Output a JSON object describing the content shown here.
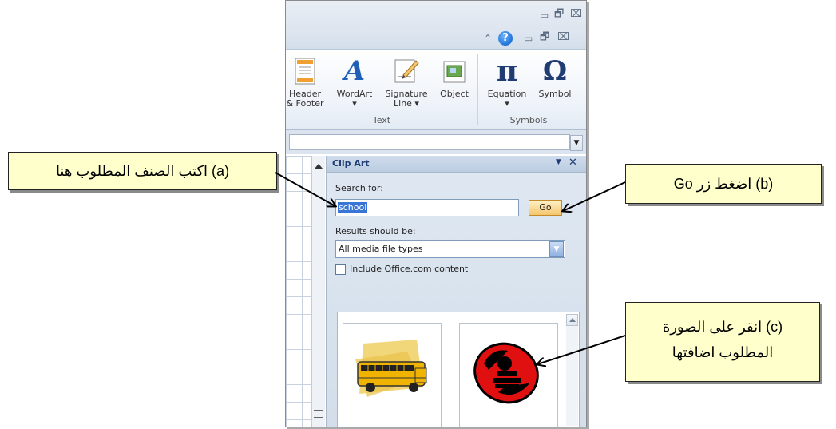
{
  "ribbon": {
    "buttons": [
      {
        "label_line1": "Header",
        "label_line2": "& Footer",
        "icon": "header-footer-icon"
      },
      {
        "label_line1": "WordArt",
        "label_line2": "▾",
        "icon": "wordart-icon"
      },
      {
        "label_line1": "Signature",
        "label_line2": "Line ▾",
        "icon": "signature-line-icon"
      },
      {
        "label_line1": "Object",
        "label_line2": "",
        "icon": "object-icon"
      },
      {
        "label_line1": "Equation",
        "label_line2": "▾",
        "icon": "equation-icon"
      },
      {
        "label_line1": "Symbol",
        "label_line2": "",
        "icon": "symbol-icon"
      }
    ],
    "groups": [
      "Text",
      "Symbols"
    ],
    "equation_glyph": "π",
    "symbol_glyph": "Ω",
    "wordart_glyph": "A"
  },
  "window_controls": {
    "minimize": "▭",
    "restore": "🗗",
    "close": "⌧",
    "help": "?",
    "collapse": "⌃"
  },
  "clipart": {
    "title": "Clip Art",
    "search_label": "Search for:",
    "search_value": "school",
    "go_label": "Go",
    "results_label": "Results should be:",
    "results_value": "All media file types",
    "include_label": "Include Office.com content",
    "include_checked": false
  },
  "callouts": {
    "a": "(a) اكتب الصنف المطلوب هنا",
    "b": "(b) اضغط زر Go",
    "c_line1": "(c) انقر على الصورة",
    "c_line2": "المطلوب اضافتها"
  },
  "colors": {
    "accent": "#1f3c73",
    "callout_bg": "#ffffcc",
    "go_button": "#f5c56b",
    "help": "#1e73d8"
  }
}
